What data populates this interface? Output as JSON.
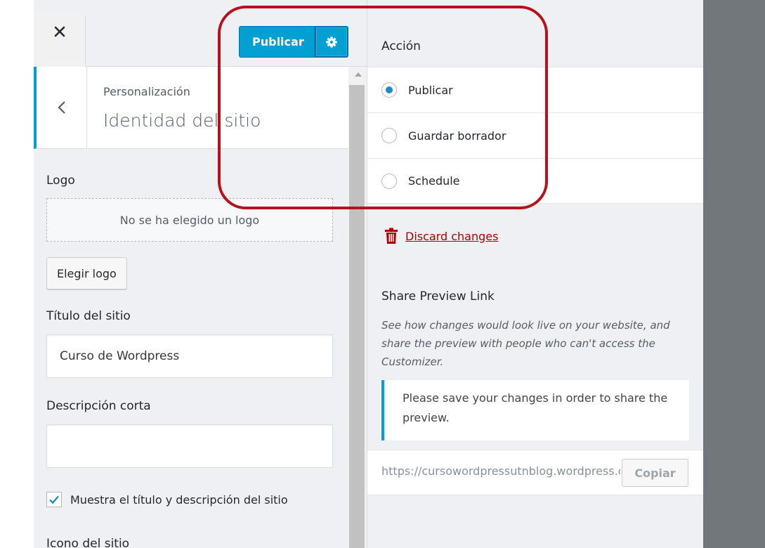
{
  "header": {
    "close_icon": "close-icon",
    "publish_label": "Publicar",
    "settings_icon": "gear-icon"
  },
  "section": {
    "breadcrumb": "Personalización",
    "title": "Identidad del sitio",
    "back_icon": "chevron-left-icon",
    "accent_color": "#00a0d2"
  },
  "site_identity": {
    "logo_label": "Logo",
    "logo_placeholder": "No se ha elegido un logo",
    "choose_logo_button": "Elegir logo",
    "site_title_label": "Título del sitio",
    "site_title_value": "Curso de Wordpress",
    "tagline_label": "Descripción corta",
    "tagline_value": "",
    "display_checkbox_label": "Muestra el título y descripción del sitio",
    "display_checkbox_checked": true,
    "site_icon_label": "Icono del sitio"
  },
  "publish_settings": {
    "action_label": "Acción",
    "options": [
      {
        "label": "Publicar",
        "selected": true
      },
      {
        "label": "Guardar borrador",
        "selected": false
      },
      {
        "label": "Schedule",
        "selected": false
      }
    ],
    "discard_label": "Discard changes",
    "discard_icon": "trash-icon",
    "share_title": "Share Preview Link",
    "share_description": "See how changes would look live on your website, and share the preview with people who can't access the Customizer.",
    "notice_text": "Please save your changes in order to share the preview.",
    "preview_link": "https://cursowordpressutnblog.wordpress.com",
    "copy_button": "Copiar"
  },
  "colors": {
    "primary": "#00a0d2",
    "danger": "#a00000",
    "annotation": "#b5121b"
  }
}
